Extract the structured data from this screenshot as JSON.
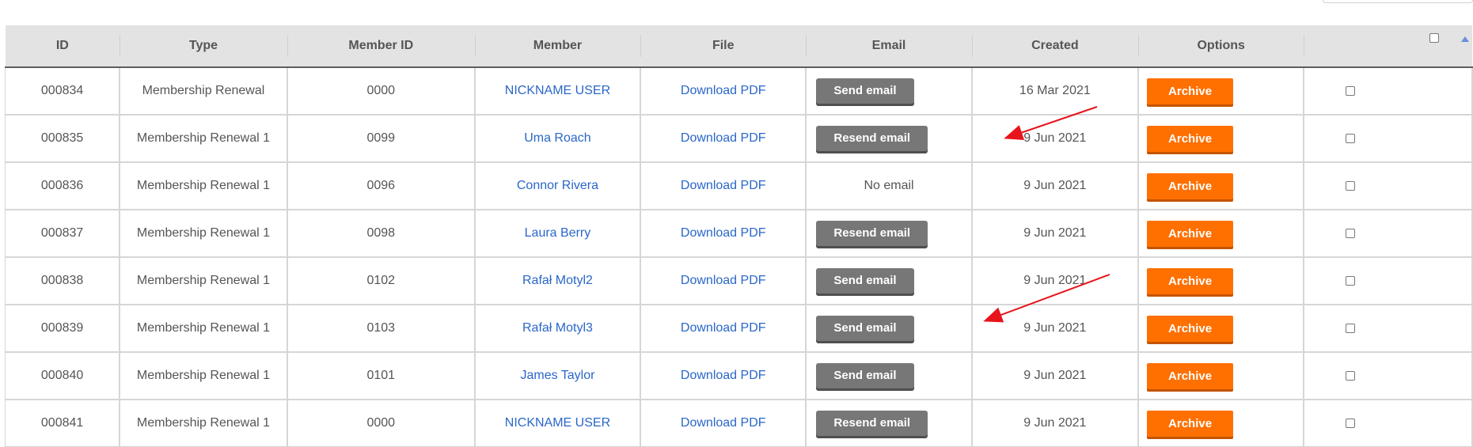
{
  "columns": [
    "ID",
    "Type",
    "Member ID",
    "Member",
    "File",
    "Email",
    "Created",
    "Options"
  ],
  "rows": [
    {
      "id": "000834",
      "type": "Membership Renewal",
      "member_id": "0000",
      "member": "NICKNAME USER",
      "file": "Download PDF",
      "email": "Send email",
      "email_kind": "button",
      "created": "16 Mar 2021",
      "option": "Archive"
    },
    {
      "id": "000835",
      "type": "Membership Renewal 1",
      "member_id": "0099",
      "member": "Uma Roach",
      "file": "Download PDF",
      "email": "Resend email",
      "email_kind": "button",
      "created": "9 Jun 2021",
      "option": "Archive"
    },
    {
      "id": "000836",
      "type": "Membership Renewal 1",
      "member_id": "0096",
      "member": "Connor Rivera",
      "file": "Download PDF",
      "email": "No email",
      "email_kind": "text",
      "created": "9 Jun 2021",
      "option": "Archive"
    },
    {
      "id": "000837",
      "type": "Membership Renewal 1",
      "member_id": "0098",
      "member": "Laura Berry",
      "file": "Download PDF",
      "email": "Resend email",
      "email_kind": "button",
      "created": "9 Jun 2021",
      "option": "Archive"
    },
    {
      "id": "000838",
      "type": "Membership Renewal 1",
      "member_id": "0102",
      "member": "Rafał Motyl2",
      "file": "Download PDF",
      "email": "Send email",
      "email_kind": "button",
      "created": "9 Jun 2021",
      "option": "Archive"
    },
    {
      "id": "000839",
      "type": "Membership Renewal 1",
      "member_id": "0103",
      "member": "Rafał Motyl3",
      "file": "Download PDF",
      "email": "Send email",
      "email_kind": "button",
      "created": "9 Jun 2021",
      "option": "Archive"
    },
    {
      "id": "000840",
      "type": "Membership Renewal 1",
      "member_id": "0101",
      "member": "James Taylor",
      "file": "Download PDF",
      "email": "Send email",
      "email_kind": "button",
      "created": "9 Jun 2021",
      "option": "Archive"
    },
    {
      "id": "000841",
      "type": "Membership Renewal 1",
      "member_id": "0000",
      "member": "NICKNAME USER",
      "file": "Download PDF",
      "email": "Resend email",
      "email_kind": "button",
      "created": "9 Jun 2021",
      "option": "Archive"
    }
  ],
  "colors": {
    "header_bg": "#e3e3e3",
    "link": "#2a66c9",
    "email_button": "#777777",
    "archive_button": "#ff7000",
    "annotation_arrow": "#e8141b"
  },
  "icons": {
    "sort": "sort-asc-icon",
    "select_all": "checkbox-icon"
  }
}
